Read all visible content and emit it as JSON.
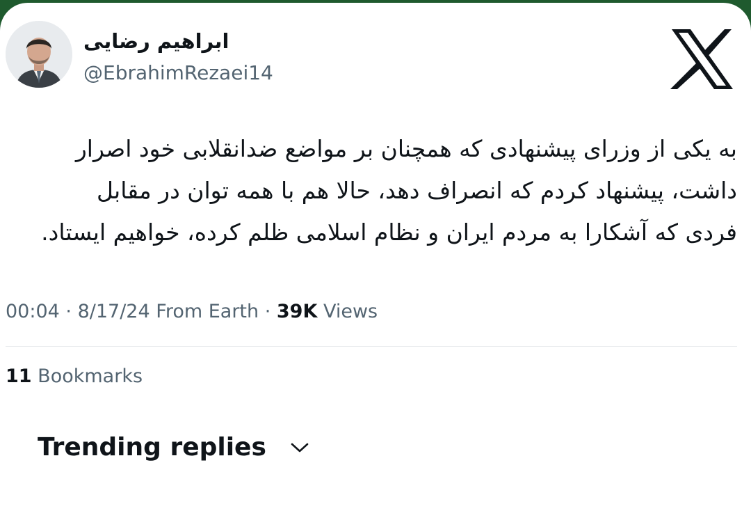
{
  "author": {
    "display_name": "ابراهیم رضایی",
    "handle": "@EbrahimRezaei14",
    "avatar_icon": "user-avatar"
  },
  "brand": {
    "logo_icon": "x-logo",
    "color": "#0f1419"
  },
  "tweet": {
    "lines": [
      "به یکی از وزرای پیشنهادی که همچنان بر مواضع ضدانقلابی خود اصرار",
      "داشت، پیشنهاد کردم که انصراف دهد، حالا هم با همه توان در مقابل",
      "فردی که آشکارا به مردم ایران و نظام اسلامی ظلم کرده، خواهیم ایستاد."
    ]
  },
  "meta": {
    "time": "00:04",
    "separator": " · ",
    "date": "8/17/24",
    "source": "From Earth",
    "views_count": "39K",
    "views_label": "Views"
  },
  "stats": {
    "bookmarks_count": "11",
    "bookmarks_label": "Bookmarks"
  },
  "replies": {
    "sort_label": "Trending replies",
    "chevron_icon": "chevron-down-icon"
  },
  "colors": {
    "background_frame": "#1f5a2e",
    "text_primary": "#0f1419",
    "text_secondary": "#536471",
    "divider": "#e6e9ec"
  }
}
